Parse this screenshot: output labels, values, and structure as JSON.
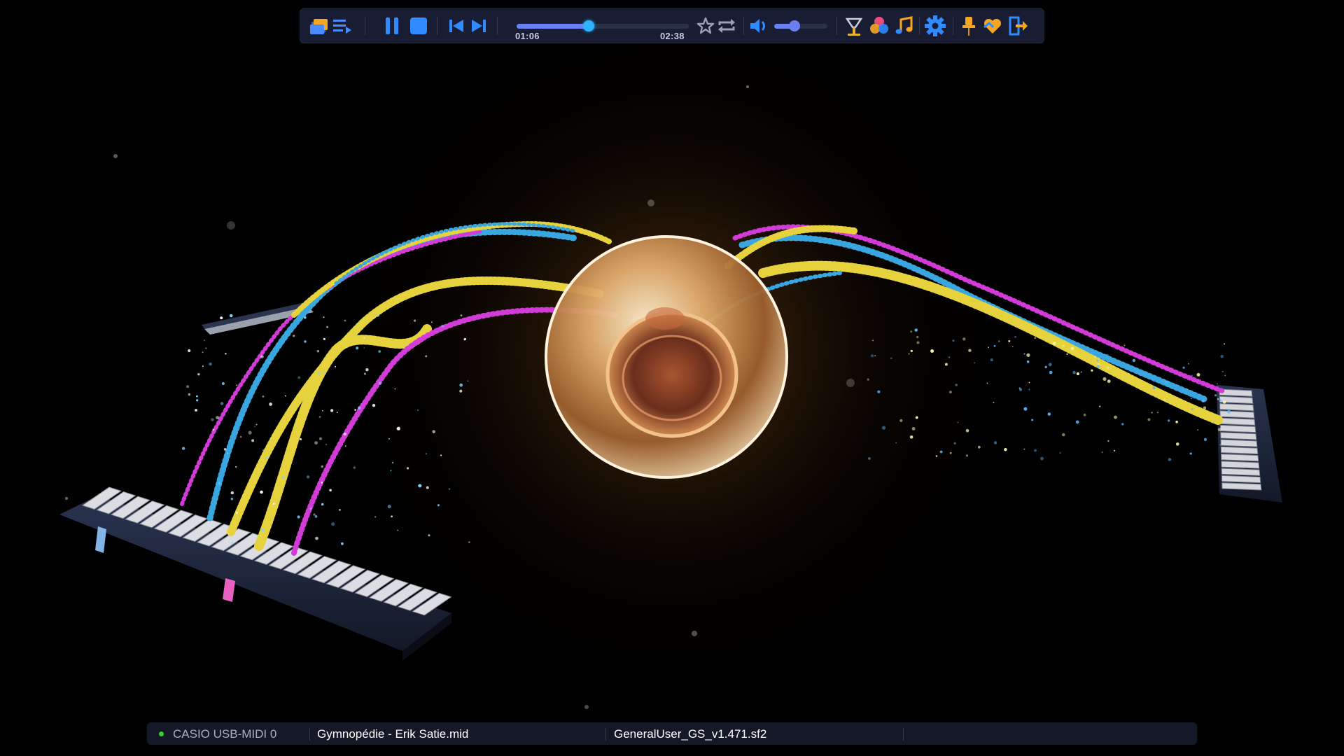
{
  "toolbar": {
    "buttons": [
      {
        "name": "open-files-icon",
        "color": "#f5a623"
      },
      {
        "name": "playlist-icon",
        "color": "#4a8cff"
      },
      {
        "name": "pause-icon",
        "color": "#2f8bff"
      },
      {
        "name": "stop-icon",
        "color": "#2f8bff"
      },
      {
        "name": "previous-track-icon",
        "color": "#2f8bff"
      },
      {
        "name": "next-track-icon",
        "color": "#2f8bff"
      },
      {
        "name": "favorite-star-icon",
        "color": "#9aa0b5"
      },
      {
        "name": "repeat-icon",
        "color": "#9aa0b5"
      },
      {
        "name": "volume-icon",
        "color": "#2f8bff"
      },
      {
        "name": "visualizer-effects-icon",
        "color": "#e6b22e"
      },
      {
        "name": "color-themes-icon",
        "color": "#e94c7a"
      },
      {
        "name": "music-note-icon",
        "color": "#f5a623"
      },
      {
        "name": "settings-gear-icon",
        "color": "#2f8bff"
      },
      {
        "name": "pin-icon",
        "color": "#f5a623"
      },
      {
        "name": "support-heart-icon",
        "color": "#f5a623"
      },
      {
        "name": "exit-icon",
        "color": "#2f8bff"
      }
    ],
    "elapsed": "01:06",
    "duration": "02:38",
    "progress_fraction": 0.42,
    "volume_fraction": 0.38
  },
  "status": {
    "midi_device": "CASIO USB-MIDI 0",
    "midi_connected_color": "#2cd62c",
    "midi_file": "Gymnopédie - Erik Satie.mid",
    "soundfont": "GeneralUser_GS_v1.471.sf2",
    "text_color_muted": "#a9aec2",
    "text_color_main": "#ffffff"
  }
}
